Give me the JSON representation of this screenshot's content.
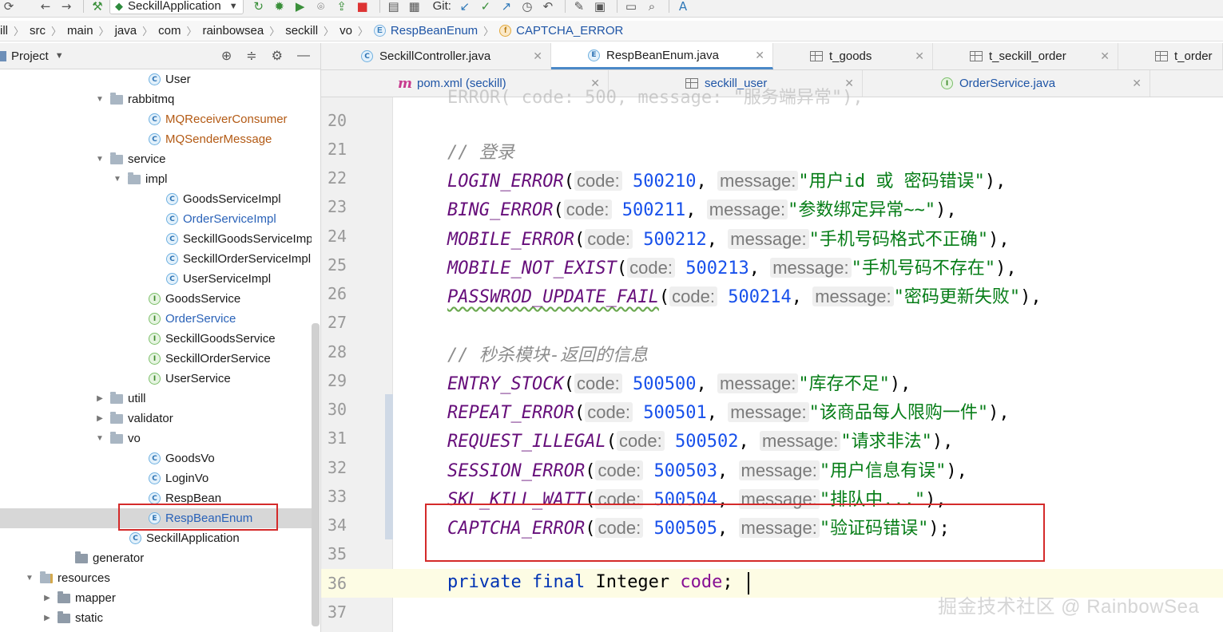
{
  "toolbar": {
    "run_config": "SeckillApplication",
    "git_label": "Git:"
  },
  "breadcrumb": [
    "ill",
    "src",
    "main",
    "java",
    "com",
    "rainbowsea",
    "seckill",
    "vo",
    "RespBeanEnum",
    "CAPTCHA_ERROR"
  ],
  "project_panel": {
    "title": "Project",
    "tree": [
      {
        "label": "User",
        "type": "class",
        "color": "default"
      },
      {
        "label": "rabbitmq",
        "type": "folder",
        "expanded": true
      },
      {
        "label": "MQReceiverConsumer",
        "type": "class",
        "color": "orange"
      },
      {
        "label": "MQSenderMessage",
        "type": "class",
        "color": "orange"
      },
      {
        "label": "service",
        "type": "folder",
        "expanded": true
      },
      {
        "label": "impl",
        "type": "folder",
        "expanded": true
      },
      {
        "label": "GoodsServiceImpl",
        "type": "class",
        "color": "default"
      },
      {
        "label": "OrderServiceImpl",
        "type": "class",
        "color": "blue"
      },
      {
        "label": "SeckillGoodsServiceImpl",
        "type": "class",
        "color": "default"
      },
      {
        "label": "SeckillOrderServiceImpl",
        "type": "class",
        "color": "default"
      },
      {
        "label": "UserServiceImpl",
        "type": "class",
        "color": "default"
      },
      {
        "label": "GoodsService",
        "type": "interface",
        "color": "default"
      },
      {
        "label": "OrderService",
        "type": "interface",
        "color": "blue"
      },
      {
        "label": "SeckillGoodsService",
        "type": "interface",
        "color": "default"
      },
      {
        "label": "SeckillOrderService",
        "type": "interface",
        "color": "default"
      },
      {
        "label": "UserService",
        "type": "interface",
        "color": "default"
      },
      {
        "label": "utill",
        "type": "folder",
        "expanded": false
      },
      {
        "label": "validator",
        "type": "folder",
        "expanded": false
      },
      {
        "label": "vo",
        "type": "folder",
        "expanded": true
      },
      {
        "label": "GoodsVo",
        "type": "class",
        "color": "default"
      },
      {
        "label": "LoginVo",
        "type": "class",
        "color": "default"
      },
      {
        "label": "RespBean",
        "type": "class",
        "color": "default"
      },
      {
        "label": "RespBeanEnum",
        "type": "enum",
        "color": "blue",
        "selected": true
      },
      {
        "label": "SeckillApplication",
        "type": "app",
        "color": "default"
      },
      {
        "label": "generator",
        "type": "folder",
        "expanded": null
      },
      {
        "label": "resources",
        "type": "folder",
        "expanded": true
      },
      {
        "label": "mapper",
        "type": "folder",
        "expanded": false
      },
      {
        "label": "static",
        "type": "folder",
        "expanded": false
      }
    ]
  },
  "tabs_row1": [
    {
      "label": "SeckillController.java",
      "icon": "class"
    },
    {
      "label": "RespBeanEnum.java",
      "icon": "enum",
      "active": true
    },
    {
      "label": "t_goods",
      "icon": "table"
    },
    {
      "label": "t_seckill_order",
      "icon": "table"
    },
    {
      "label": "t_order",
      "icon": "table"
    }
  ],
  "tabs_row2": [
    {
      "label": "pom.xml (seckill)",
      "icon": "maven"
    },
    {
      "label": "seckill_user",
      "icon": "table"
    },
    {
      "label": "OrderService.java",
      "icon": "interface"
    }
  ],
  "editor": {
    "top_cut_line": "ERROR( code: 500, message: \"服务端异常\"),",
    "lines": [
      {
        "num": "20",
        "kind": "blank"
      },
      {
        "num": "21",
        "kind": "comment",
        "text": "// 登录"
      },
      {
        "num": "22",
        "kind": "enum",
        "name": "LOGIN_ERROR",
        "code": "500210",
        "message": "\"用户id 或 密码错误\"",
        "end": "),"
      },
      {
        "num": "23",
        "kind": "enum",
        "name": "BING_ERROR",
        "code": "500211",
        "message": "\"参数绑定异常~~\"",
        "end": "),"
      },
      {
        "num": "24",
        "kind": "enum",
        "name": "MOBILE_ERROR",
        "code": "500212",
        "message": "\"手机号码格式不正确\"",
        "end": "),"
      },
      {
        "num": "25",
        "kind": "enum",
        "name": "MOBILE_NOT_EXIST",
        "code": "500213",
        "message": "\"手机号码不存在\"",
        "end": "),"
      },
      {
        "num": "26",
        "kind": "enum",
        "name": "PASSWROD_UPDATE_FAIL",
        "code": "500214",
        "message": "\"密码更新失败\"",
        "end": "),",
        "wavy": true
      },
      {
        "num": "27",
        "kind": "blank"
      },
      {
        "num": "28",
        "kind": "comment",
        "text": "// 秒杀模块-返回的信息"
      },
      {
        "num": "29",
        "kind": "enum",
        "name": "ENTRY_STOCK",
        "code": "500500",
        "message": "\"库存不足\"",
        "end": "),"
      },
      {
        "num": "30",
        "kind": "enum",
        "name": "REPEAT_ERROR",
        "code": "500501",
        "message": "\"该商品每人限购一件\"",
        "end": "),"
      },
      {
        "num": "31",
        "kind": "enum",
        "name": "REQUEST_ILLEGAL",
        "code": "500502",
        "message": "\"请求非法\"",
        "end": "),"
      },
      {
        "num": "32",
        "kind": "enum",
        "name": "SESSION_ERROR",
        "code": "500503",
        "message": "\"用户信息有误\"",
        "end": "),"
      },
      {
        "num": "33",
        "kind": "enum",
        "name": "SKL_KILL_WATT",
        "code": "500504",
        "message": "\"排队中...\"",
        "end": "),"
      },
      {
        "num": "34",
        "kind": "enum",
        "name": "CAPTCHA_ERROR",
        "code": "500505",
        "message": "\"验证码错误\"",
        "end": ");"
      },
      {
        "num": "35",
        "kind": "blank"
      },
      {
        "num": "36",
        "kind": "field",
        "kw1": "private",
        "kw2": "final",
        "type": "Integer",
        "field": "code",
        "end": ";"
      },
      {
        "num": "37",
        "kind": "blank"
      }
    ],
    "hint_code": "code:",
    "hint_message": "message:"
  },
  "watermark": "掘金技术社区 @ RainbowSea"
}
